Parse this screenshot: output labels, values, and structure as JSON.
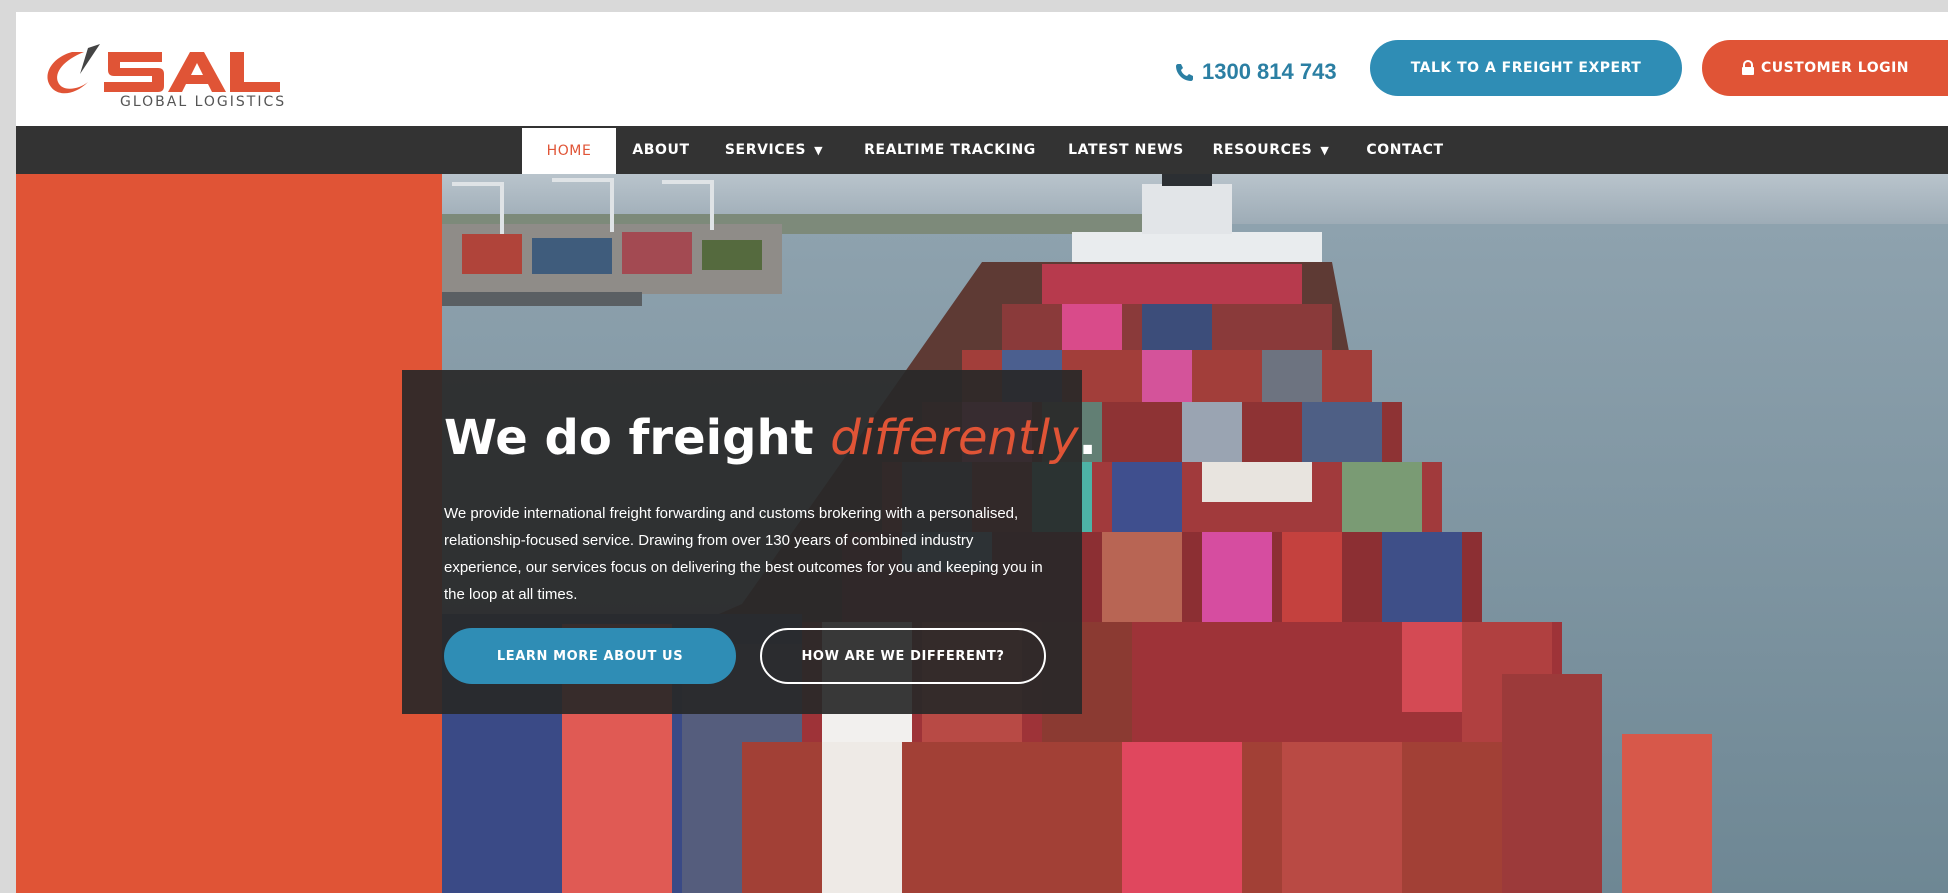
{
  "brand": {
    "logo_text": "SAL",
    "logo_subtitle": "GLOBAL LOGISTICS",
    "accent_color": "#e05436",
    "teal_color": "#2f8db5"
  },
  "header": {
    "phone": "1300 814 743",
    "expert_button": "TALK TO A FREIGHT EXPERT",
    "login_button": "CUSTOMER LOGIN"
  },
  "nav": {
    "items": [
      {
        "label": "HOME",
        "active": true
      },
      {
        "label": "ABOUT"
      },
      {
        "label": "SERVICES",
        "dropdown": true
      },
      {
        "label": "REALTIME TRACKING"
      },
      {
        "label": "LATEST NEWS"
      },
      {
        "label": "RESOURCES",
        "dropdown": true
      },
      {
        "label": "CONTACT"
      }
    ]
  },
  "hero": {
    "title_main": "We do freight ",
    "title_accent": "differently",
    "title_end": ".",
    "body": "We provide international freight forwarding and customs brokering with a personalised, relationship-focused service. Drawing from over 130 years of combined industry experience, our services focus on delivering the best outcomes for you and keeping you in the loop at all times.",
    "primary_button": "LEARN MORE ABOUT US",
    "secondary_button": "HOW ARE WE DIFFERENT?"
  }
}
